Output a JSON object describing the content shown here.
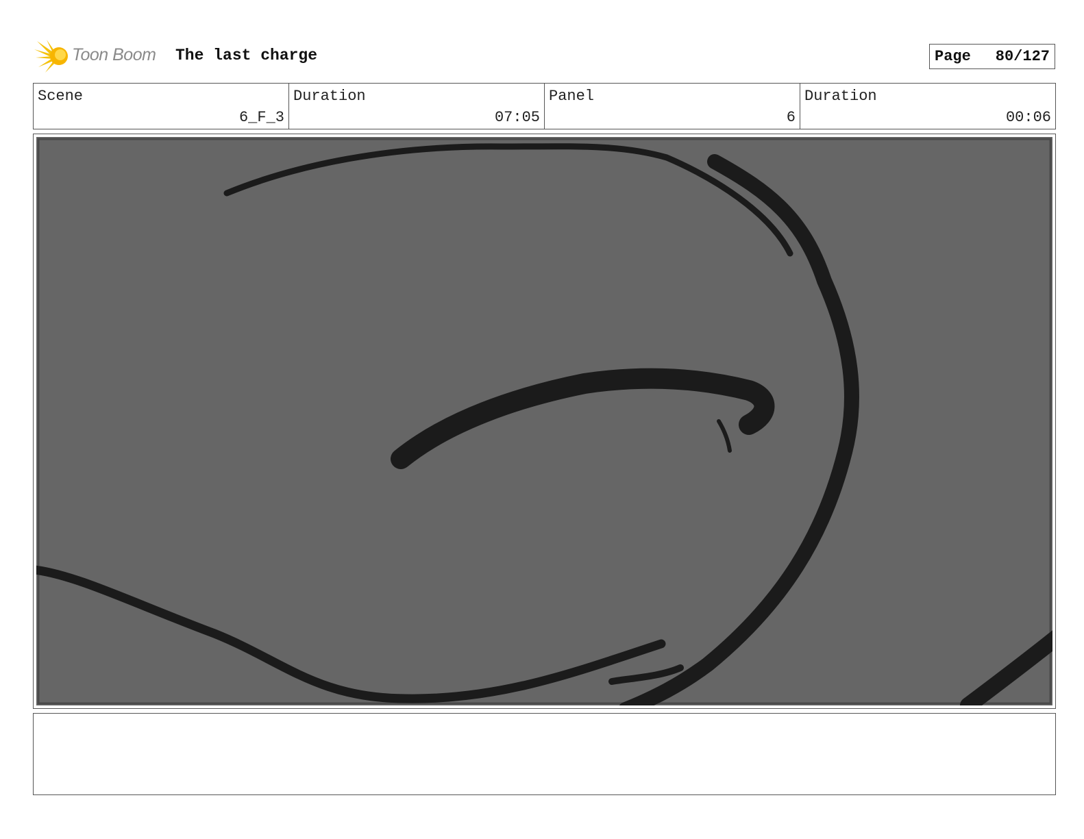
{
  "header": {
    "logo_text": "Toon Boom",
    "title": "The last charge",
    "page_label": "Page",
    "page_number": "80/127"
  },
  "info": {
    "scene_label": "Scene",
    "scene_value": "6_F_3",
    "scene_duration_label": "Duration",
    "scene_duration_value": "07:05",
    "panel_label": "Panel",
    "panel_value": "6",
    "panel_duration_label": "Duration",
    "panel_duration_value": "00:06"
  },
  "panel": {
    "background_color": "#666666",
    "stroke_color": "#1b1b1b"
  },
  "notes": {
    "text": ""
  }
}
